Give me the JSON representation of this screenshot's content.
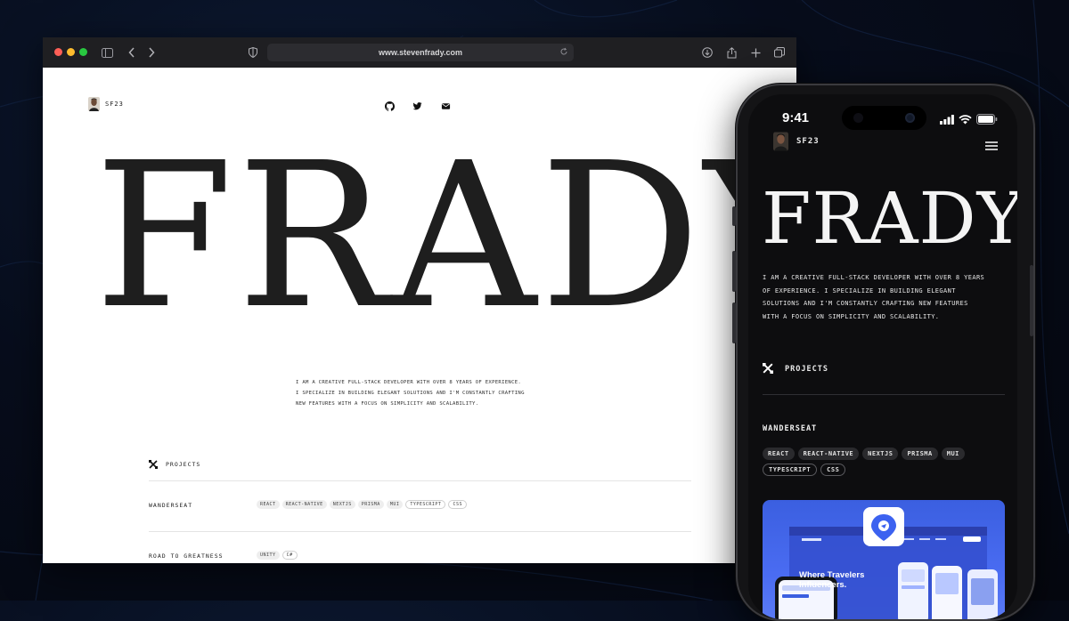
{
  "browser": {
    "url": "www.stevenfrady.com"
  },
  "site": {
    "brand": "SF23",
    "hero_name": "FRADY",
    "bio_lines": [
      "I AM A CREATIVE FULL-STACK DEVELOPER WITH OVER 8 YEARS OF EXPERIENCE.",
      "I SPECIALIZE IN BUILDING ELEGANT SOLUTIONS AND I'M CONSTANTLY CRAFTING",
      "NEW FEATURES WITH A FOCUS ON SIMPLICITY AND SCALABILITY."
    ],
    "projects_label": "PROJECTS",
    "projects": [
      {
        "name": "WANDERSEAT",
        "tags": [
          "REACT",
          "REACT-NATIVE",
          "NEXTJS",
          "PRISMA",
          "MUI",
          "TYPESCRIPT",
          "CSS"
        ]
      },
      {
        "name": "ROAD TO GREATNESS",
        "tags": [
          "UNITY",
          "C#"
        ]
      }
    ]
  },
  "phone": {
    "time": "9:41",
    "brand": "SF23",
    "hero_name": "FRADY",
    "bio_lines": [
      "I AM A CREATIVE FULL-STACK DEVELOPER WITH OVER 8 YEARS",
      "OF EXPERIENCE. I SPECIALIZE IN BUILDING ELEGANT",
      "SOLUTIONS AND I'M CONSTANTLY CRAFTING NEW FEATURES",
      "WITH A FOCUS ON SIMPLICITY AND SCALABILITY."
    ],
    "projects_label": "PROJECTS",
    "project_name": "WANDERSEAT",
    "tags": [
      "REACT",
      "REACT-NATIVE",
      "NEXTJS",
      "PRISMA",
      "MUI",
      "TYPESCRIPT",
      "CSS"
    ],
    "preview_text_line1": "Where Travelers",
    "preview_text_line2": "Influencers."
  },
  "colors": {
    "background": "#070d1c",
    "toolbar": "#1f1f22",
    "phone_screen": "#0d0d0f",
    "preview_blue": "#4a6cf2"
  }
}
